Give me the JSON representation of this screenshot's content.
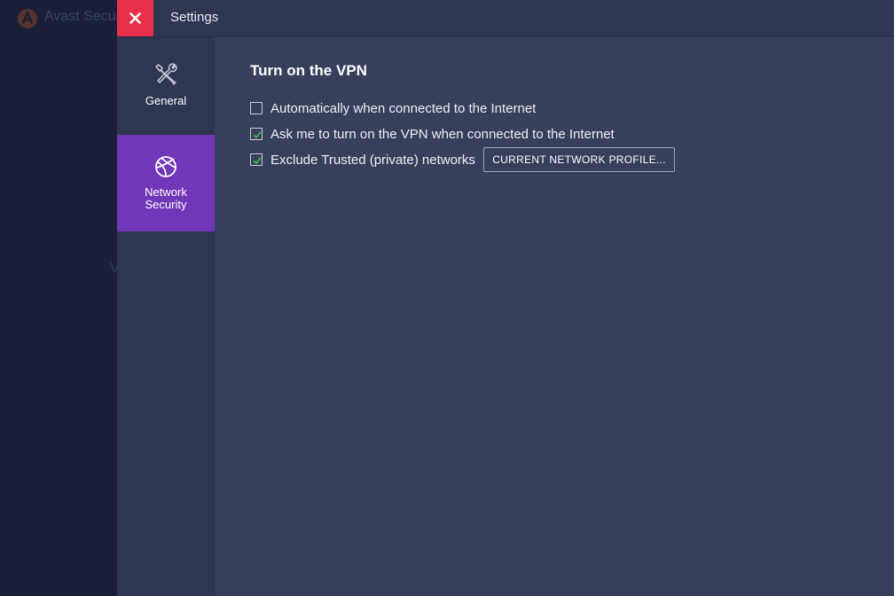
{
  "background_app": {
    "title": "Avast Secure",
    "partial_text": "V"
  },
  "window": {
    "title": "Settings"
  },
  "sidebar": {
    "items": [
      {
        "label": "General",
        "icon": "wrench-screwdriver-icon",
        "active": false
      },
      {
        "label": "Network\nSecurity",
        "icon": "globe-icon",
        "active": true
      }
    ]
  },
  "main": {
    "section_title": "Turn on the VPN",
    "options": [
      {
        "label": "Automatically when connected to the Internet",
        "checked": false
      },
      {
        "label": "Ask me to turn on the VPN when connected to the Internet",
        "checked": true
      },
      {
        "label": "Exclude Trusted (private) networks",
        "checked": true
      }
    ],
    "profile_button": "CURRENT NETWORK PROFILE..."
  },
  "colors": {
    "close": "#e8304a",
    "active_nav": "#7236b8",
    "check": "#3bb54a",
    "panel": "#373f5c"
  }
}
